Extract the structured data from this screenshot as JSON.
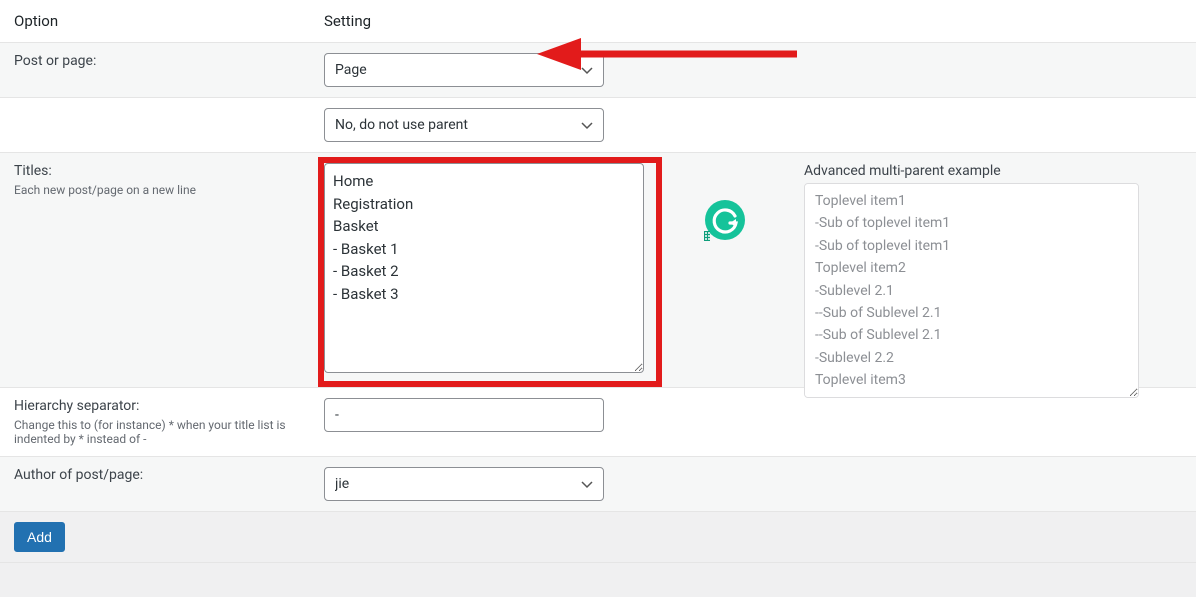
{
  "header": {
    "option": "Option",
    "setting": "Setting"
  },
  "rows": {
    "post_or_page": {
      "label": "Post or page:",
      "value": "Page"
    },
    "parent": {
      "value": "No, do not use parent"
    },
    "titles": {
      "label": "Titles:",
      "sub": "Each new post/page on a new line",
      "value": "Home\nRegistration\nBasket\n- Basket 1\n- Basket 2\n- Basket 3",
      "example_title": "Advanced multi-parent example",
      "example_value": "Toplevel item1\n-Sub of toplevel item1\n-Sub of toplevel item1\nToplevel item2\n-Sublevel 2.1\n--Sub of Sublevel 2.1\n--Sub of Sublevel 2.1\n-Sublevel 2.2\nToplevel item3"
    },
    "separator": {
      "label": "Hierarchy separator:",
      "sub": "Change this to (for instance) * when your title list is indented by * instead of -",
      "value": "-"
    },
    "author": {
      "label": "Author of post/page:",
      "value": "jie"
    }
  },
  "add_button": "Add",
  "icons": {
    "grammarly_color": "#15c39a"
  }
}
